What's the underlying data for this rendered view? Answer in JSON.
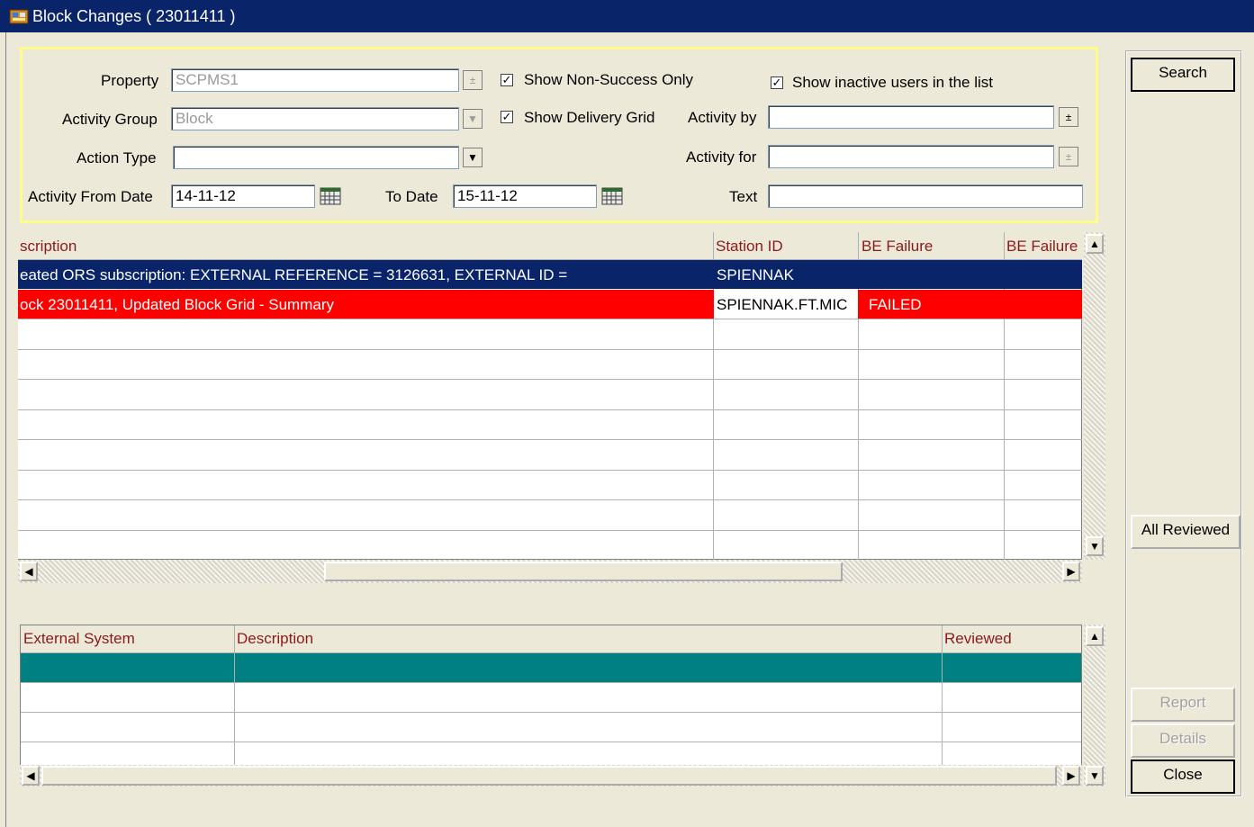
{
  "window": {
    "title": "Block Changes ( 23011411 )"
  },
  "filters": {
    "property_label": "Property",
    "property_value": "SCPMS1",
    "activity_group_label": "Activity Group",
    "activity_group_value": "Block",
    "action_type_label": "Action Type",
    "action_type_value": "",
    "activity_from_date_label": "Activity From Date",
    "activity_from_date_value": "14-11-12",
    "to_date_label": "To Date",
    "to_date_value": "15-11-12",
    "show_non_success_label": "Show Non-Success Only",
    "show_non_success_checked": true,
    "show_delivery_grid_label": "Show Delivery Grid",
    "show_delivery_grid_checked": true,
    "show_inactive_label": "Show inactive users in the list",
    "show_inactive_checked": true,
    "activity_by_label": "Activity by",
    "activity_by_value": "",
    "activity_for_label": "Activity for",
    "activity_for_value": "",
    "text_label": "Text",
    "text_value": ""
  },
  "upper_grid": {
    "columns": [
      "scription",
      "Station ID",
      "BE Failure",
      "BE Failure"
    ],
    "rows": [
      {
        "description": "eated ORS subscription: EXTERNAL REFERENCE = 3126631, EXTERNAL ID =",
        "station_id": "SPIENNAK",
        "be_failure": "",
        "be_failure2": "",
        "state": "selected"
      },
      {
        "description": "ock 23011411, Updated Block Grid - Summary",
        "station_id": "SPIENNAK.FT.MIC",
        "be_failure": "FAILED",
        "be_failure2": "",
        "state": "failed"
      }
    ]
  },
  "lower_grid": {
    "columns": [
      "External System",
      "Description",
      "Reviewed"
    ]
  },
  "buttons": {
    "search": "Search",
    "all_reviewed": "All Reviewed",
    "report": "Report",
    "details": "Details",
    "close": "Close"
  },
  "colors": {
    "title_bar": "#0a246a",
    "selected_row": "#0a246a",
    "failed_row": "#ff0000",
    "lower_selected_row": "#008080",
    "header_text": "#8b1a1a",
    "filter_border": "#fefc8a"
  }
}
